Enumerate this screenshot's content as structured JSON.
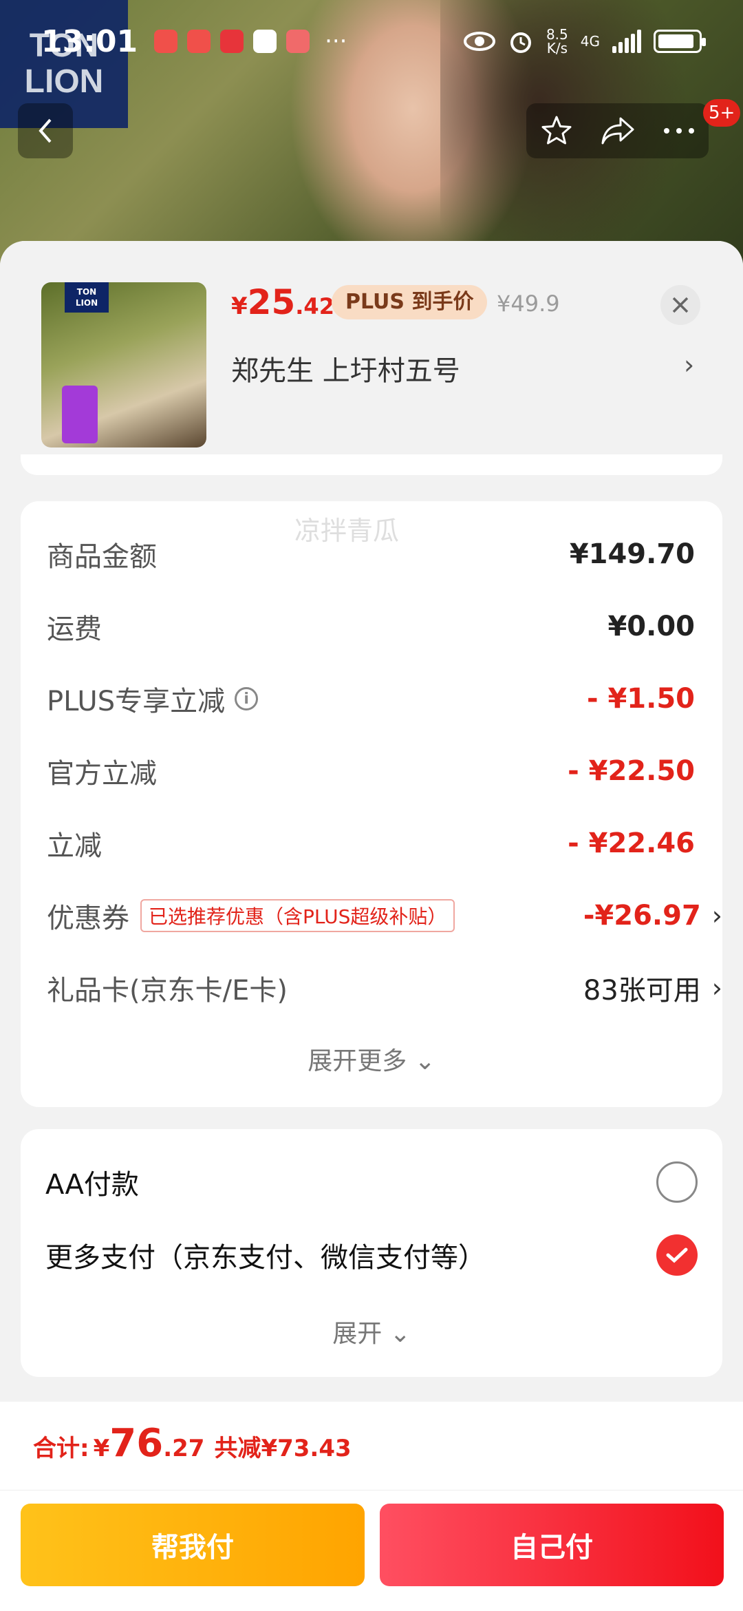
{
  "status_bar": {
    "time": "13:01",
    "more": "···",
    "net_speed": "8.5\nK/s",
    "network": "4G"
  },
  "hero": {
    "brand_logo_line1": "TON",
    "brand_logo_line2": "LION"
  },
  "nav": {
    "cart_badge": "5+"
  },
  "product": {
    "price_currency": "¥",
    "price_int": "25",
    "price_dec": ".42",
    "plus_tag": "PLUS 到手价",
    "original_price": "¥49.9",
    "address": "郑先生  上圩村五号",
    "thumb_brand": "TON LION"
  },
  "price_details": {
    "rows": [
      {
        "label": "商品金额",
        "value": "¥149.70"
      },
      {
        "label": "运费",
        "value": "¥0.00"
      },
      {
        "label": "PLUS专享立减",
        "value": "- ¥1.50"
      },
      {
        "label": "官方立减",
        "value": "- ¥22.50"
      },
      {
        "label": "立减",
        "value": "- ¥22.46"
      },
      {
        "label": "优惠券",
        "tag": "已选推荐优惠（含PLUS超级补贴）",
        "value": "-¥26.97"
      },
      {
        "label": "礼品卡(京东卡/E卡)",
        "value": "83张可用"
      }
    ],
    "expand_more": "展开更多 ⌄",
    "watermark": "凉拌青瓜"
  },
  "payment": {
    "options": [
      {
        "label": "AA付款",
        "selected": false
      },
      {
        "label": "更多支付（京东支付、微信支付等）",
        "selected": true
      }
    ],
    "expand": "展开 ⌄"
  },
  "footer": {
    "total_label": "合计:",
    "total_currency": "¥",
    "total_int": "76",
    "total_dec": ".27",
    "total_save": "共减¥73.43",
    "help_pay": "帮我付",
    "self_pay": "自己付"
  },
  "colors": {
    "accent_red": "#e2231a",
    "help_yellow": "#ffa400",
    "brand_blue": "#0e2566"
  },
  "icons": [
    "back-icon",
    "star-icon",
    "share-icon",
    "more-icon",
    "close-icon",
    "chevron-right-icon",
    "info-icon",
    "check-icon",
    "eye-icon",
    "alarm-icon",
    "battery-icon",
    "signal-icon"
  ]
}
